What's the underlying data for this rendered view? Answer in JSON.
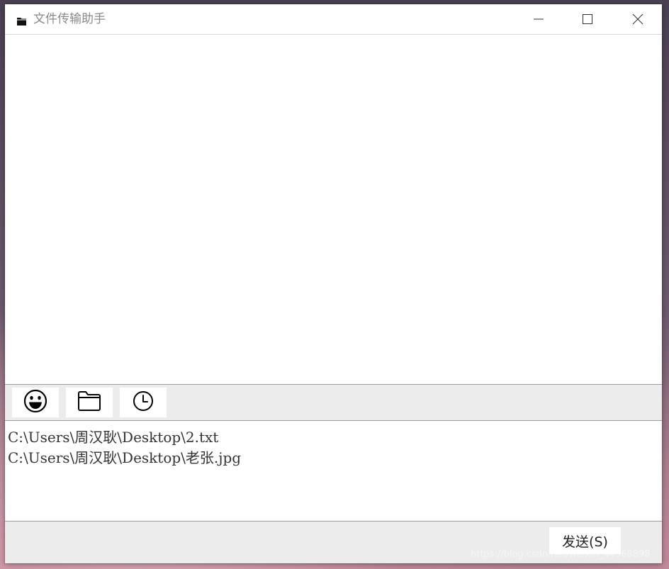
{
  "window": {
    "title": "文件传输助手",
    "title_icon": "folder-icon",
    "controls": {
      "minimize_icon": "minimize-icon",
      "maximize_icon": "maximize-icon",
      "close_icon": "close-icon"
    }
  },
  "toolbar": {
    "items": [
      {
        "name": "emoji",
        "icon": "smiley-icon"
      },
      {
        "name": "file",
        "icon": "folder-icon"
      },
      {
        "name": "history",
        "icon": "clock-icon"
      }
    ]
  },
  "input": {
    "lines": [
      "C:\\Users\\周汉耿\\Desktop\\2.txt",
      "C:\\Users\\周汉耿\\Desktop\\老张.jpg"
    ]
  },
  "footer": {
    "send_label": "发送(S)",
    "watermark": "https://blog.csdn.net/weixin_44568898"
  },
  "colors": {
    "title_text": "#8a8a8a",
    "panel_gray": "#ececec",
    "border": "#9d9d9d",
    "text": "#333333"
  }
}
